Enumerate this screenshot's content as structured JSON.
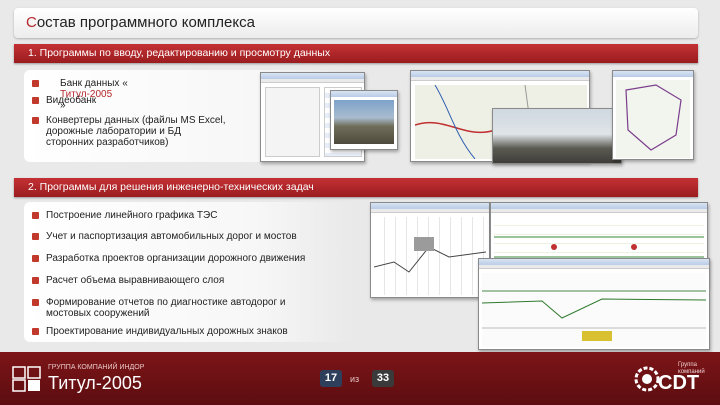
{
  "title": {
    "first_letter": "С",
    "rest": "остав программного комплекса"
  },
  "sections": [
    {
      "header": "1. Программы по вводу, редактированию и просмотру данных",
      "bullets": [
        {
          "before": "Банк данных «",
          "accent": "Титул-2005",
          "after": "»"
        },
        {
          "text": "Видеобанк"
        },
        {
          "text": "Конвертеры данных (файлы MS Excel,\nдорожные лаборатории и БД\nсторонних разработчиков)"
        }
      ]
    },
    {
      "header": "2. Программы для решения инженерно-технических задач",
      "bullets": [
        {
          "text": "Построение линейного графика ТЭС"
        },
        {
          "text": "Учет и паспортизация автомобильных дорог и мостов"
        },
        {
          "text": "Разработка проектов организации дорожного движения"
        },
        {
          "text": "Расчет объема выравнивающего слоя"
        },
        {
          "text": "Формирование отчетов по диагностике автодорог и\nмостовых сооружений"
        },
        {
          "text": "Проектирование индивидуальных дорожных знаков"
        }
      ]
    }
  ],
  "footer": {
    "company": "ГРУППА КОМПАНИЙ ИНДОР",
    "brand": "Титул-2005",
    "page_current": "17",
    "page_separator": "из",
    "page_total": "33",
    "logo_text": "CDT",
    "logo_subtitle": "Группа компаний"
  },
  "colors": {
    "accent": "#b3282d",
    "header": "#a8232a",
    "footer": "#6b1013",
    "page_current_bg": "#2e3f5c"
  }
}
